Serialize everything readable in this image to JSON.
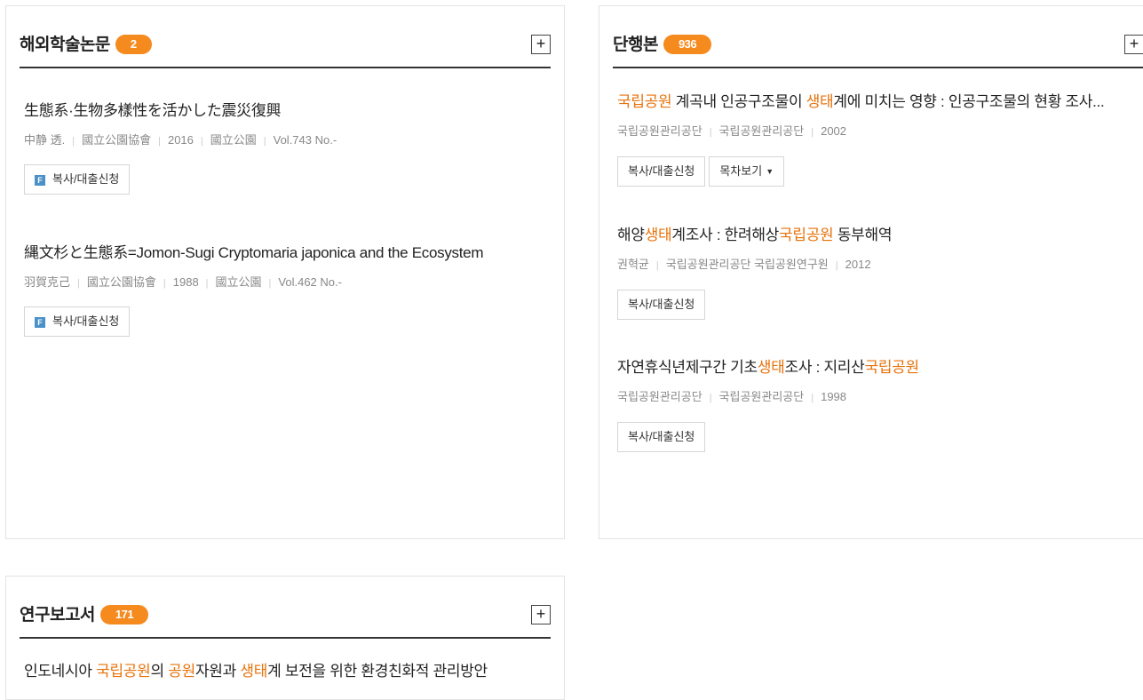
{
  "foreign_papers": {
    "title": "해외학술논문",
    "count": "2",
    "more_label": "+",
    "items": [
      {
        "title": "生態系·生物多樣性を活かした震災復興",
        "meta": [
          "中静 透.",
          "國立公園協會",
          "2016",
          "國立公園",
          "Vol.743 No.-"
        ],
        "btn_label": "복사/대출신청",
        "btn_icon": "F"
      },
      {
        "title": "縄文杉と生態系=Jomon-Sugi Cryptomaria japonica and the Ecosystem",
        "meta": [
          "羽賀克己",
          "國立公園協會",
          "1988",
          "國立公園",
          "Vol.462 No.-"
        ],
        "btn_label": "복사/대출신청",
        "btn_icon": "F"
      }
    ]
  },
  "monographs": {
    "title": "단행본",
    "count": "936",
    "more_label": "+",
    "items": [
      {
        "title_parts": [
          "국립공원",
          " 계곡내 인공구조물이 ",
          "생태",
          "계에 미치는 영향 : 인공구조물의 현황 조사..."
        ],
        "meta": [
          "국립공원관리공단",
          "국립공원관리공단",
          "2002"
        ],
        "btn_label": "복사/대출신청",
        "toc_label": "목차보기",
        "toc_icon": "▼"
      },
      {
        "title_parts": [
          "해양",
          "생태",
          "계조사 : 한려해상",
          "국립공원",
          " 동부해역"
        ],
        "meta": [
          "권혁균",
          "국립공원관리공단 국립공원연구원",
          "2012"
        ],
        "btn_label": "복사/대출신청"
      },
      {
        "title_parts": [
          "자연휴식년제구간 기초",
          "생태",
          "조사 : 지리산",
          "국립공원"
        ],
        "meta": [
          "국립공원관리공단",
          "국립공원관리공단",
          "1998"
        ],
        "btn_label": "복사/대출신청"
      }
    ]
  },
  "reports": {
    "title": "연구보고서",
    "count": "171",
    "more_label": "+",
    "items": [
      {
        "title_parts": [
          "인도네시아 ",
          "국립공원",
          "의 ",
          "공원",
          "자원과 ",
          "생태",
          "계 보전을 위한 환경친화적 관리방안"
        ]
      }
    ]
  },
  "colors": {
    "accent": "#f58a1f",
    "highlight": "#e8730c"
  }
}
